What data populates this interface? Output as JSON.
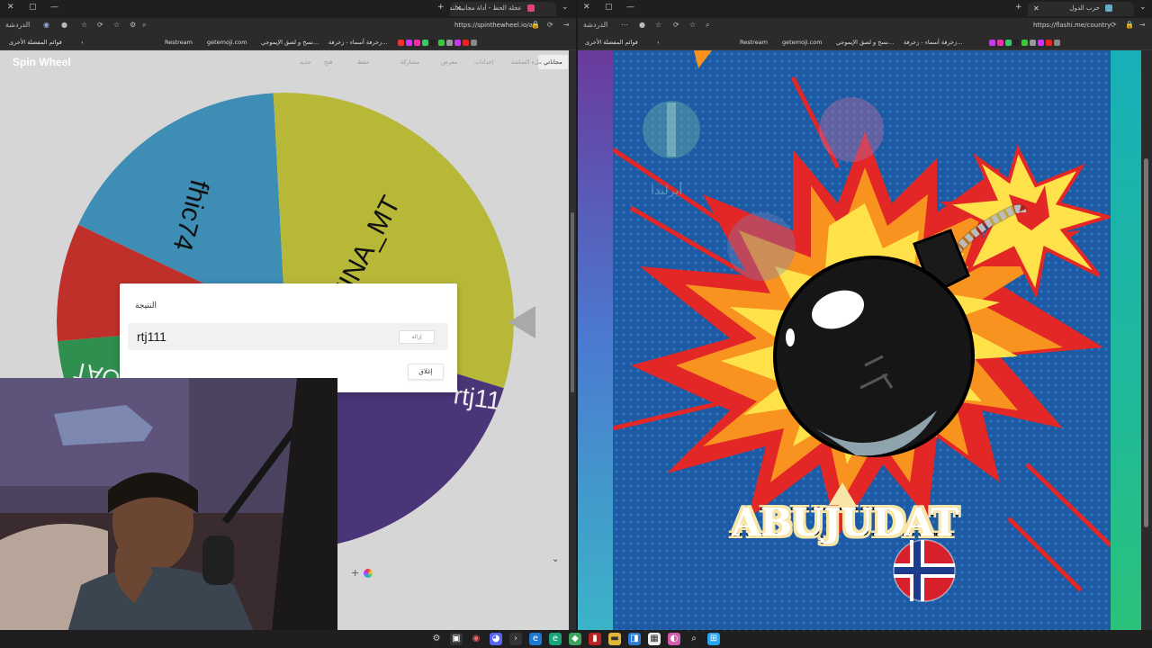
{
  "left_browser": {
    "tab_title": "عجلة الحظ - أداة مجانية لتدوير العجلة",
    "url": "https://spinthewheel.io/ar",
    "bookmarks": [
      "قوائم المفضلة الأخرى",
      "Restream",
      "getemoji.com",
      "نسخ و لصق الإيموجي...",
      "زخرفة أسماء - زخرفة..."
    ],
    "profile_label": "الدردشة"
  },
  "spin_app": {
    "logo": "Spin Wheel",
    "toolbar_items": [
      "مجاناتي",
      "جديد",
      "فتح",
      "حفظ",
      "مشاركة",
      "معرض",
      "إعدادات",
      "ملء الشاشة"
    ],
    "wheel_segments": [
      {
        "label": "fhic74",
        "color": "#3d8db5"
      },
      {
        "label": "ZINA_MT",
        "color": "#b8b838"
      },
      {
        "label": "rtj111",
        "color": "#4a3578"
      },
      {
        "label": "",
        "color": "#e07a1f"
      },
      {
        "label": "",
        "color": "#2f8f4f"
      },
      {
        "label": "OAT",
        "color": "#c0302a"
      }
    ]
  },
  "result_modal": {
    "title": "النتيجة",
    "winner": "rtj111",
    "remove_label": "إزالة",
    "close_label": "إغلاق"
  },
  "right_browser": {
    "tab_title": "حرب الدول",
    "url": "https://flashi.me/country",
    "bookmarks": [
      "قوائم المفضلة الأخرى",
      "Restream",
      "getemoji.com",
      "نسخ و لصق الإيموجي...",
      "زخرفة أسماء - زخرفة..."
    ],
    "profile_label": "الدردشة"
  },
  "poster": {
    "name": "ABUJUDAT",
    "faded_label": "أيرلندا",
    "colors": {
      "burst_red": "#e32626",
      "burst_orange": "#f7931e",
      "burst_yellow": "#ffe14a",
      "bomb": "#161616",
      "background": "#1d5aa3"
    }
  },
  "taskbar": {
    "icons": [
      "settings-icon",
      "app-icon",
      "app-icon",
      "discord-icon",
      "terminal-icon",
      "edge-icon",
      "edge-icon",
      "map-icon",
      "app-icon",
      "folder-icon",
      "app-icon",
      "store-icon",
      "app-icon",
      "search-icon",
      "windows-icon"
    ]
  }
}
